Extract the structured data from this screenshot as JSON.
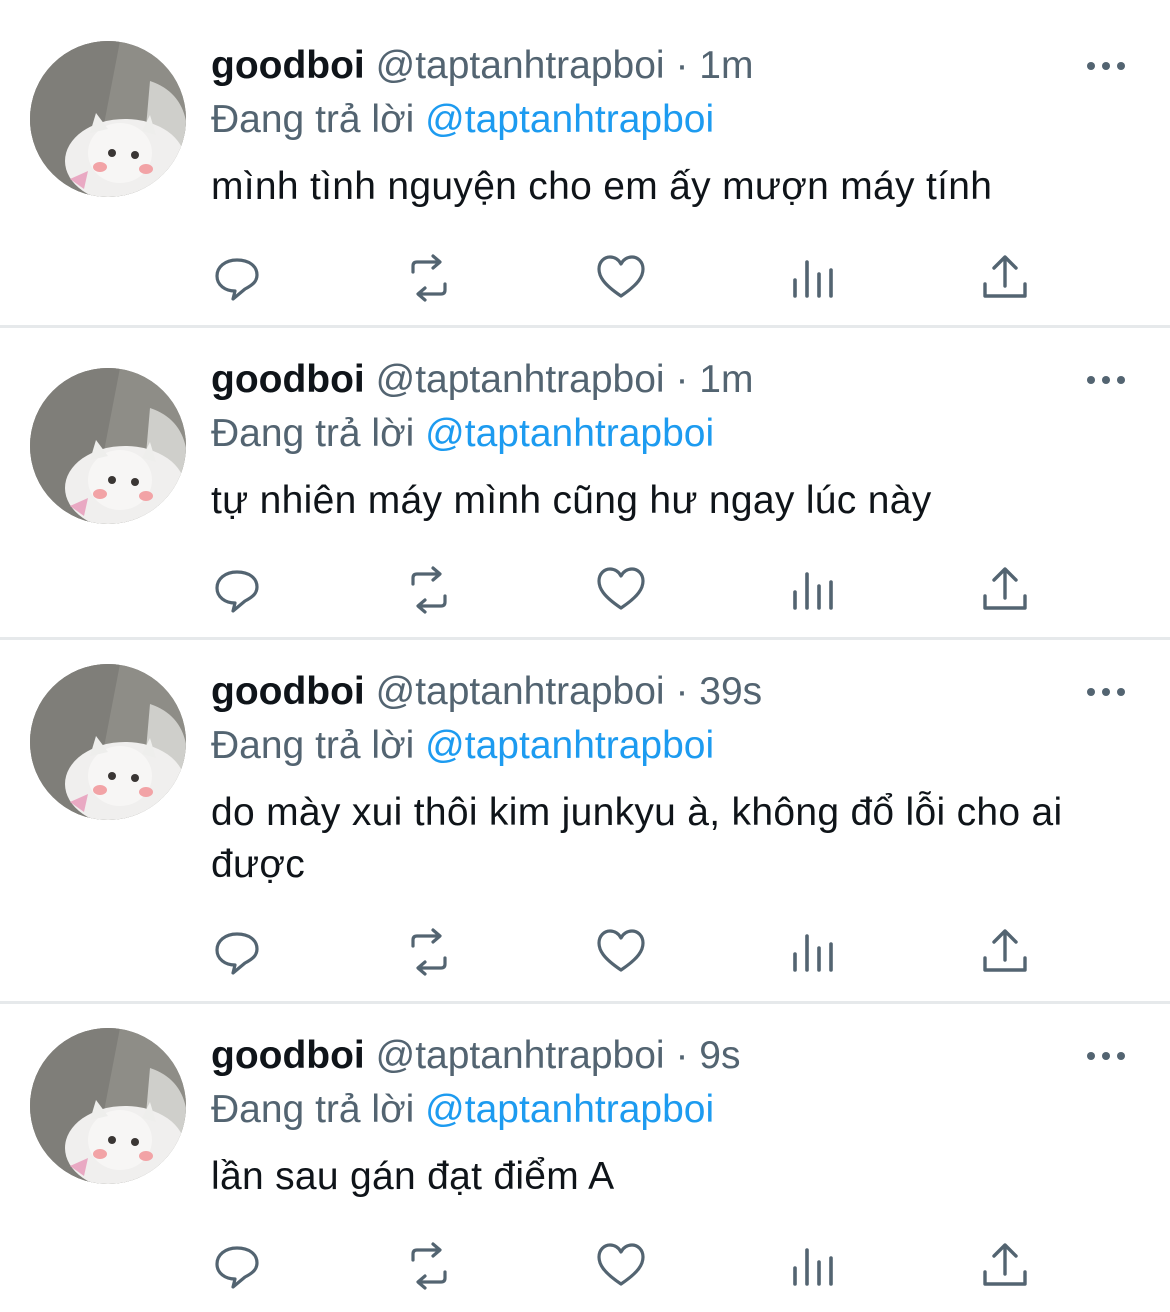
{
  "tweets": [
    {
      "name": "goodboi",
      "handle": "@taptanhtrapboi",
      "separator": "·",
      "time": "1m",
      "reply_prefix": "Đang trả lời",
      "reply_to": "@taptanhtrapboi",
      "text": "mình tình nguyện cho em ấy mượn máy tính"
    },
    {
      "name": "goodboi",
      "handle": "@taptanhtrapboi",
      "separator": "·",
      "time": "1m",
      "reply_prefix": "Đang trả lời",
      "reply_to": "@taptanhtrapboi",
      "text": "tự nhiên máy mình cũng hư ngay lúc này"
    },
    {
      "name": "goodboi",
      "handle": "@taptanhtrapboi",
      "separator": "·",
      "time": "39s",
      "reply_prefix": "Đang trả lời",
      "reply_to": "@taptanhtrapboi",
      "text": "do mày xui thôi kim junkyu à, không đổ lỗi cho ai được"
    },
    {
      "name": "goodboi",
      "handle": "@taptanhtrapboi",
      "separator": "·",
      "time": "9s",
      "reply_prefix": "Đang trả lời",
      "reply_to": "@taptanhtrapboi",
      "text": "lần sau gán đạt điểm A"
    }
  ],
  "icons": {
    "more": "more-icon",
    "reply": "reply-icon",
    "retweet": "retweet-icon",
    "like": "like-icon",
    "stats": "stats-icon",
    "share": "share-icon"
  },
  "colors": {
    "text": "#0f1419",
    "secondary": "#536471",
    "link": "#1d9bf0",
    "divider": "#e6e9eb",
    "icon": "#536471"
  }
}
